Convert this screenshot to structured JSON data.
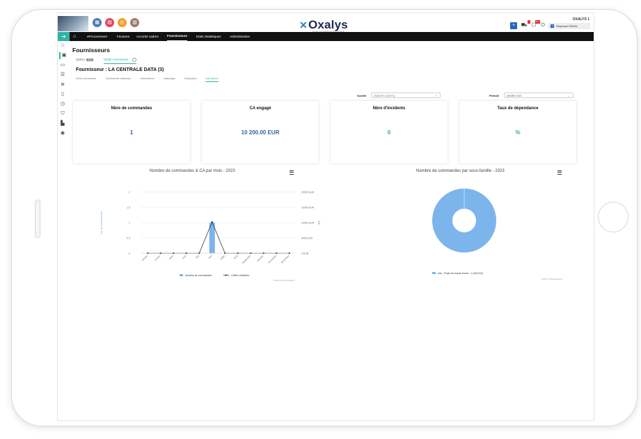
{
  "header": {
    "logo": "Oxalys",
    "tagline": "Toutes vos achats en bonne santé",
    "company": "OXALYS 1",
    "user": "Stéphane ERAIN",
    "user_initial": "S",
    "cart_badge": "1",
    "notif_badge": "99+"
  },
  "nav": {
    "items": [
      "eProcurement",
      "Factures",
      "Accords cadres",
      "Fournisseurs",
      "Etats Statistiques",
      "Administration"
    ],
    "active": "Fournisseurs"
  },
  "page": {
    "title": "Fournisseurs",
    "subtabs": [
      {
        "label": "Option",
        "count": "231"
      },
      {
        "label": "Détail Fournisseur"
      }
    ],
    "supplier_title": "Fournisseur : LA CENTRALE DATA (3)",
    "tabs": [
      "Fiche fournisseur",
      "Documents rattachés",
      "Interactions",
      "Historique",
      "Evaluation",
      "Indicateurs"
    ],
    "active_tab": "Indicateurs"
  },
  "filters": {
    "societe_label": "Société",
    "societe_value": "OXALYS 1 (OXY1)",
    "periode_label": "Période",
    "periode_value": "ANNEE 2023"
  },
  "kpis": [
    {
      "title": "Nbre de commandes",
      "value": "1",
      "color": "#2e63a8"
    },
    {
      "title": "CA engagé",
      "value": "10 200.00 EUR",
      "color": "#2e63a8"
    },
    {
      "title": "Nbre d'incidents",
      "value": "0",
      "color": "#2fa79a"
    },
    {
      "title": "Taux de dépendance",
      "value": "%",
      "color": "#2fa79a"
    }
  ],
  "charts": {
    "left_title": "Nombre de commandes & CA par mois - 2023",
    "right_title": "Nombre de commandes par sous-famille - 2023",
    "credit": "OXALYS Technologies"
  },
  "chart_data": [
    {
      "type": "bar",
      "title": "Nombre de commandes & CA par mois - 2023",
      "categories": [
        "Janvier",
        "Février",
        "Mars",
        "Avril",
        "Mai",
        "Juin",
        "Juillet",
        "Août",
        "Septembre",
        "Octobre",
        "Novembre",
        "Décembre"
      ],
      "ylabel": "Nb de commandes",
      "y_ticks": [
        "0",
        "0.5",
        "1",
        "1.5",
        "2"
      ],
      "ylim": [
        0,
        2
      ],
      "y2label": "CA",
      "y2_ticks": [
        "0 EUR",
        "5000 EUR",
        "10000 EUR",
        "15000 EUR",
        "20000 EUR"
      ],
      "y2lim": [
        0,
        20000
      ],
      "series": [
        {
          "name": "Nombre de commandes",
          "type": "bar",
          "color": "#7cb5ec",
          "values": [
            0,
            0,
            0,
            0,
            0,
            1,
            0,
            0,
            0,
            0,
            0,
            0
          ]
        },
        {
          "name": "Chiffre d'affaires",
          "type": "line",
          "color": "#333333",
          "values": [
            0,
            0,
            0,
            0,
            0,
            10200,
            0,
            0,
            0,
            0,
            0,
            0
          ]
        }
      ],
      "legend": "bottom"
    },
    {
      "type": "pie",
      "title": "Nombre de commandes par sous-famille - 2023",
      "slices": [
        {
          "label": "info - Poste de travail invest : 1 (100.0%)",
          "value": 1,
          "color": "#7cb5ec"
        }
      ],
      "donut": true,
      "legend": "bottom"
    }
  ]
}
